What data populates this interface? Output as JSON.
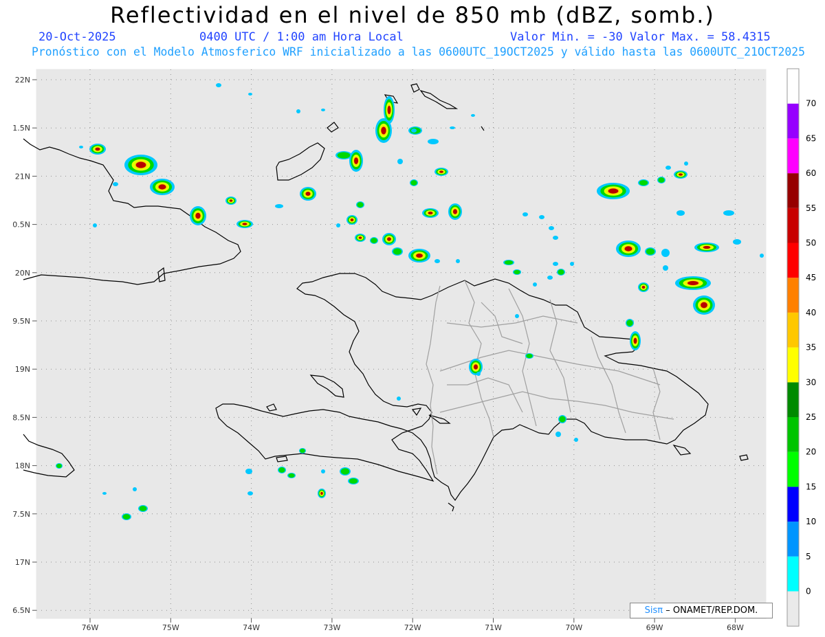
{
  "header": {
    "title": "Reflectividad en el nivel de 850 mb (dBZ, somb.)",
    "date": "20-Oct-2025",
    "time": "0400 UTC / 1:00 am Hora Local",
    "minmax": "Valor Min. = -30  Valor Max. = 58.4315",
    "model_line": "Pronóstico con el Modelo Atmosferico WRF inicializado a las 0600UTC_19OCT2025 y válido hasta las  0600UTC_21OCT2025"
  },
  "credit": {
    "logo": "Sisπ",
    "text": "– ONAMET/REP.DOM."
  },
  "chart_data": {
    "type": "heatmap",
    "variable": "Reflectividad 850 mb",
    "units": "dBZ",
    "value_min": -30,
    "value_max": 58.4315,
    "lon_range": [
      -76.7,
      -67.4
    ],
    "lat_range": [
      16.4,
      22.1
    ],
    "lat_ticks": [
      "22N",
      "1.5N",
      "21N",
      "0.5N",
      "20N",
      "9.5N",
      "19N",
      "8.5N",
      "18N",
      "7.5N",
      "17N",
      "6.5N"
    ],
    "lon_ticks": [
      "76W",
      "75W",
      "74W",
      "73W",
      "72W",
      "71W",
      "70W",
      "69W",
      "68W"
    ],
    "grid": true,
    "colorbar": {
      "labels": [
        0,
        5,
        10,
        15,
        20,
        25,
        30,
        35,
        40,
        45,
        50,
        55,
        60,
        65,
        70
      ],
      "colors": [
        "#eaeaea",
        "#00ffff",
        "#0095ff",
        "#0000ff",
        "#00ff00",
        "#00c400",
        "#008a00",
        "#ffff00",
        "#ffc800",
        "#ff8000",
        "#ff0000",
        "#c80000",
        "#960000",
        "#ff00ff",
        "#9600ff",
        "#ffffff"
      ]
    }
  }
}
